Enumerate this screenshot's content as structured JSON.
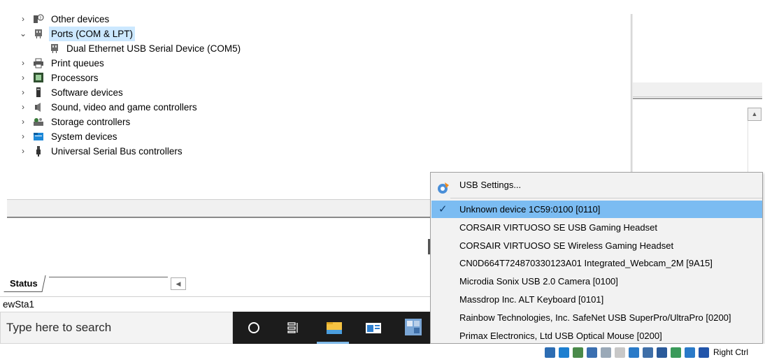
{
  "device_tree": [
    {
      "label": "Other devices",
      "icon": "unknown-device-icon",
      "expanded": false,
      "child": false,
      "selected": false
    },
    {
      "label": "Ports (COM & LPT)",
      "icon": "port-icon",
      "expanded": true,
      "child": false,
      "selected": true
    },
    {
      "label": "Dual Ethernet USB Serial Device (COM5)",
      "icon": "port-icon",
      "child": true,
      "selected": false
    },
    {
      "label": "Print queues",
      "icon": "printer-icon",
      "expanded": false,
      "child": false,
      "selected": false
    },
    {
      "label": "Processors",
      "icon": "processor-icon",
      "expanded": false,
      "child": false,
      "selected": false
    },
    {
      "label": "Software devices",
      "icon": "software-device-icon",
      "expanded": false,
      "child": false,
      "selected": false
    },
    {
      "label": "Sound, video and game controllers",
      "icon": "speaker-icon",
      "expanded": false,
      "child": false,
      "selected": false
    },
    {
      "label": "Storage controllers",
      "icon": "storage-icon",
      "expanded": false,
      "child": false,
      "selected": false
    },
    {
      "label": "System devices",
      "icon": "folder-icon",
      "expanded": false,
      "child": false,
      "selected": false
    },
    {
      "label": "Universal Serial Bus controllers",
      "icon": "usb-icon",
      "expanded": false,
      "child": false,
      "selected": false
    }
  ],
  "status_tab": {
    "label": "Status"
  },
  "name_row": {
    "text": "ewSta1"
  },
  "search": {
    "placeholder": "Type here to search"
  },
  "taskbar": {
    "buttons": [
      {
        "name": "cortana-button",
        "icon": "cortana-circle-icon"
      },
      {
        "name": "task-view-button",
        "icon": "task-view-icon"
      },
      {
        "name": "file-explorer-button",
        "icon": "folder-icon"
      },
      {
        "name": "app-window-button",
        "icon": "app-window-icon"
      },
      {
        "name": "virtualbox-button",
        "icon": "virtualbox-icon"
      }
    ]
  },
  "usb_menu": {
    "settings_label": "USB Settings...",
    "items": [
      {
        "label": "Unknown device 1C59:0100 [0110]",
        "checked": true
      },
      {
        "label": "CORSAIR VIRTUOSO SE USB Gaming Headset",
        "checked": false
      },
      {
        "label": "CORSAIR VIRTUOSO SE Wireless Gaming Headset",
        "checked": false
      },
      {
        "label": "CN0D664T724870330123A01 Integrated_Webcam_2M [9A15]",
        "checked": false
      },
      {
        "label": "Microdia Sonix USB 2.0 Camera [0100]",
        "checked": false
      },
      {
        "label": "Massdrop Inc. ALT Keyboard [0101]",
        "checked": false
      },
      {
        "label": "Rainbow Technologies, Inc. SafeNet USB SuperPro/UltraPro [0200]",
        "checked": false
      },
      {
        "label": "Primax Electronics, Ltd USB Optical Mouse [0200]",
        "checked": false
      }
    ]
  },
  "vbox_status": {
    "host_key": "Right Ctrl",
    "icons": [
      "hard-disk-icon",
      "optical-drive-icon",
      "audio-icon",
      "network-icon",
      "usb-icon",
      "shared-folders-icon",
      "display-icon",
      "video-capture-icon",
      "recording-icon",
      "cpu-icon",
      "mouse-integration-icon",
      "keyboard-icon"
    ]
  },
  "colors": {
    "selection": "#cce8ff",
    "menu_highlight": "#7bbcf2",
    "taskbar": "#1c1c1c"
  }
}
